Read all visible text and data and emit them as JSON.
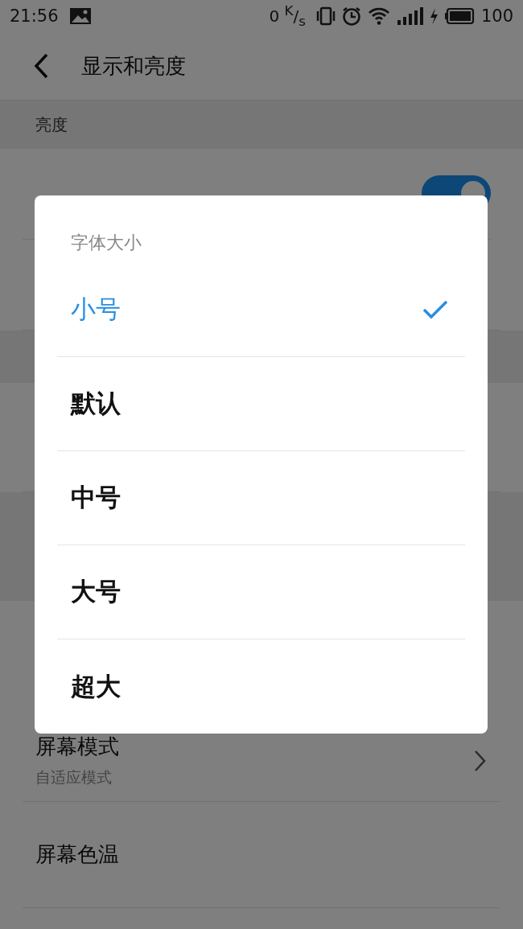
{
  "status_bar": {
    "time": "21:56",
    "speed": "0 $^{K}$/$_{s}$",
    "battery": "100"
  },
  "header": {
    "title": "显示和亮度"
  },
  "section": {
    "title": "亮度"
  },
  "auto_adjust": {
    "on": true
  },
  "rows": [
    {
      "title": "屏幕模式",
      "subtitle": "自适应模式"
    },
    {
      "title": "屏幕色温"
    }
  ],
  "dialog": {
    "title": "字体大小",
    "options": [
      {
        "label": "小号",
        "selected": true
      },
      {
        "label": "默认",
        "selected": false
      },
      {
        "label": "中号",
        "selected": false
      },
      {
        "label": "大号",
        "selected": false
      },
      {
        "label": "超大",
        "selected": false
      }
    ]
  }
}
